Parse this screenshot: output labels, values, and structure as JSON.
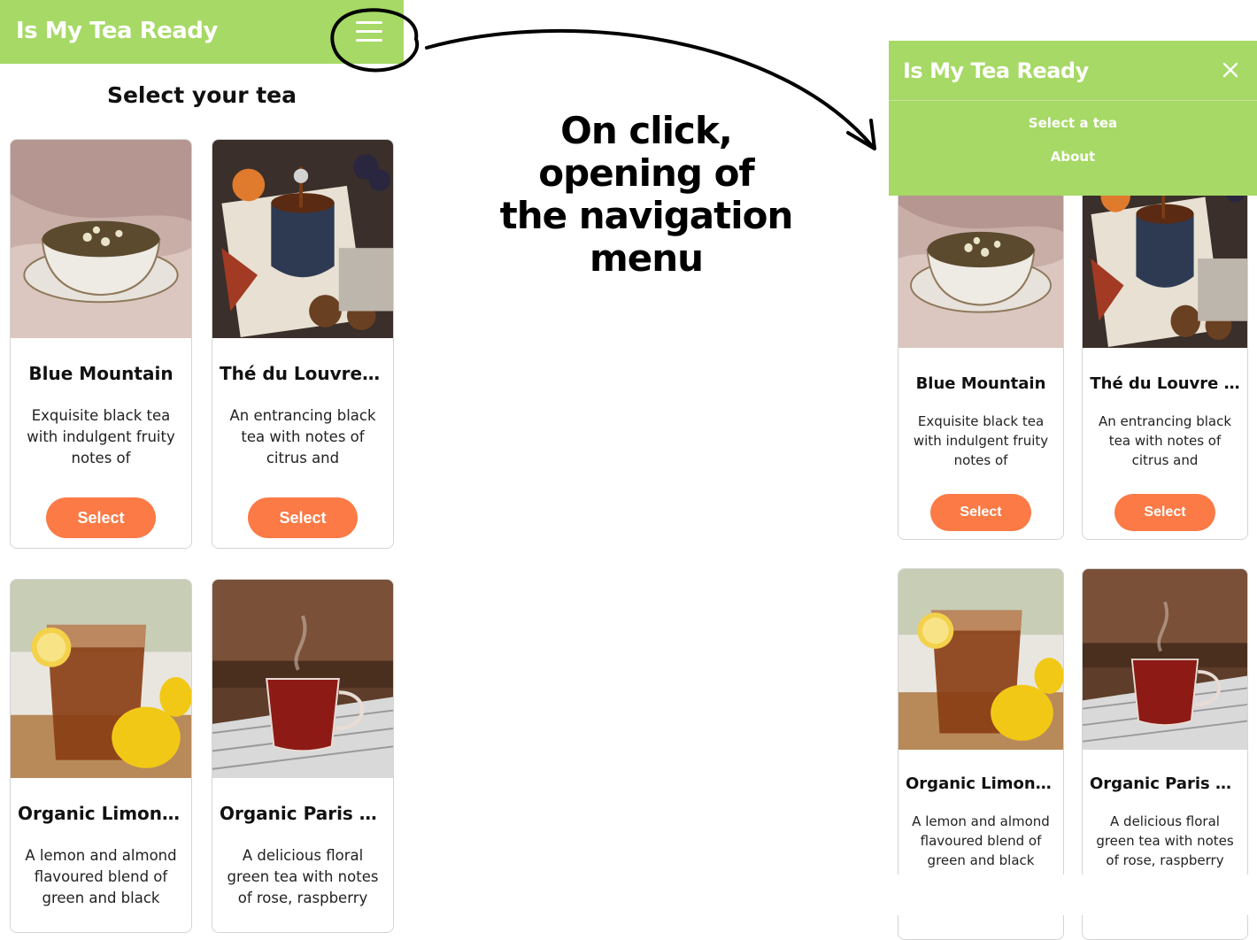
{
  "app": {
    "name": "Is My Tea Ready",
    "page_title": "Select your tea"
  },
  "teas": [
    {
      "name": "Blue Mountain",
      "description": "Exquisite black tea with indulgent fruity notes of strawberry…",
      "button": "Select",
      "image": "tea-cup-photo"
    },
    {
      "name": "Thé du Louvre …",
      "description": "An entrancing black tea with notes of citrus and blackberry.",
      "button": "Select",
      "image": "autumn-tea-photo"
    },
    {
      "name": "Organic Limonc…",
      "description": "A lemon and almond flavoured blend of green and black teas..",
      "button": "Select",
      "image": "iced-tea-photo"
    },
    {
      "name": "Organic Paris F…",
      "description": "A delicious floral green tea with notes of rose, raspberry an…",
      "button": "Select",
      "image": "glass-tea-photo"
    }
  ],
  "annotation": {
    "lines": [
      "On click,",
      "opening of",
      "the navigation",
      "menu"
    ]
  },
  "nav_menu": {
    "items": [
      "Select a tea",
      "About"
    ]
  },
  "colors": {
    "header_green": "#a6d965",
    "button_orange": "#fb7a45",
    "card_border": "#d4d4d4"
  },
  "icons": [
    "hamburger-icon",
    "close-icon",
    "curved-arrow"
  ]
}
